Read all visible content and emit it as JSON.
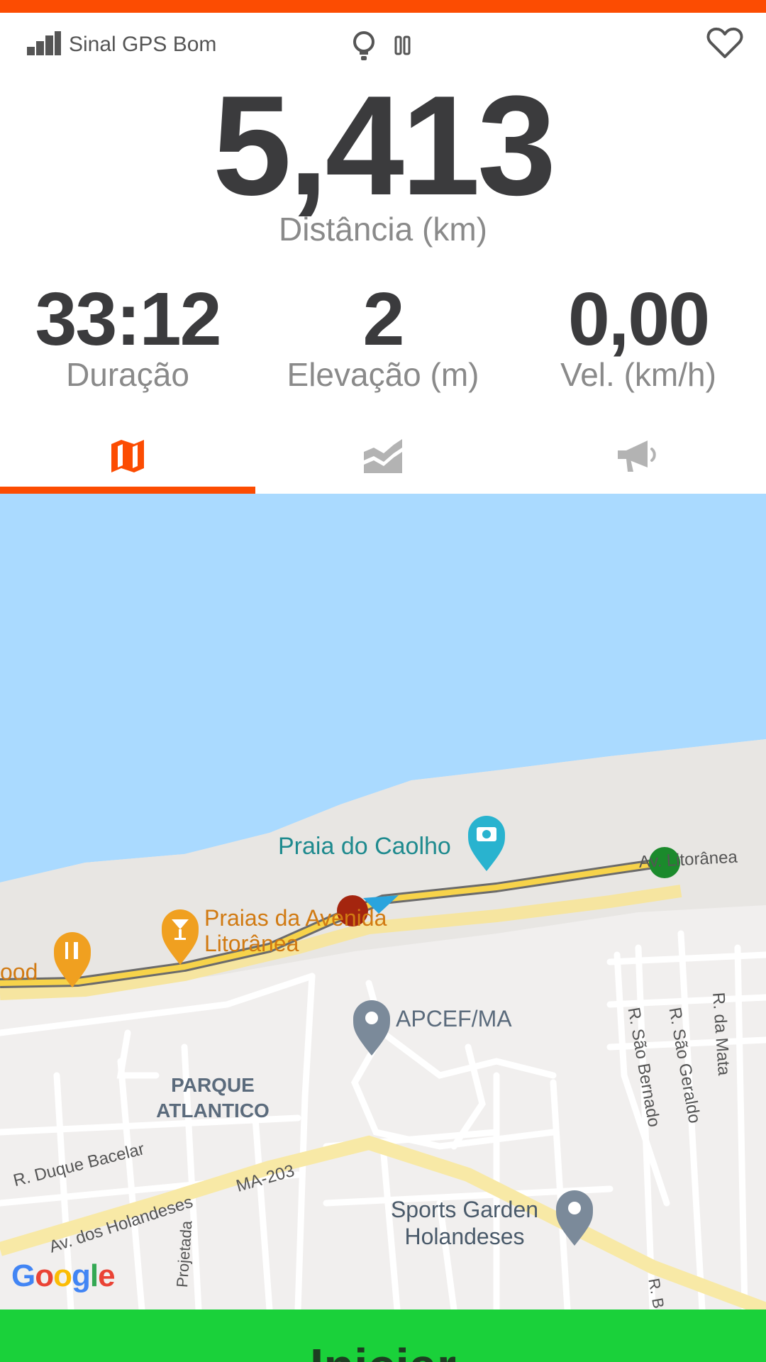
{
  "colors": {
    "accent": "#fc4c02",
    "text_dark": "#3b3b3d",
    "text_label": "#8a8a8a",
    "tab_inactive": "#b3b3b3",
    "water": "#aadaff",
    "route": "#f7d34a",
    "start_marker": "#1b8a2c",
    "current_marker": "#a4250f",
    "start_button": "#1ad13a"
  },
  "status": {
    "gps_text": "Sinal GPS Bom",
    "icons": [
      "signal-bars-icon",
      "lightbulb-icon",
      "pause-icon",
      "heart-icon"
    ]
  },
  "distance": {
    "value": "5,413",
    "label": "Distância (km)"
  },
  "stats": [
    {
      "value": "33:12",
      "label": "Duração"
    },
    {
      "value": "2",
      "label": "Elevação (m)"
    },
    {
      "value": "0,00",
      "label": "Vel. (km/h)"
    }
  ],
  "tabs": [
    {
      "icon": "map-icon",
      "active": true
    },
    {
      "icon": "area-chart-icon",
      "active": false
    },
    {
      "icon": "megaphone-icon",
      "active": false
    }
  ],
  "map": {
    "labels": {
      "praia_caolho": "Praia do Caolho",
      "praias_avenida": "Praias da Avenida\nLitorânea",
      "ood": "ood",
      "apcef": "APCEF/MA",
      "parque": "PARQUE\nATLANTICO",
      "sports_garden": "Sports Garden\nHolandeses",
      "duque_bacelar": "R. Duque Bacelar",
      "av_holandeses": "Av. dos Holandeses",
      "ma203": "MA-203",
      "projetada": "Projetada",
      "sao_bernardo": "R. São Bernado",
      "sao_geraldo": "R. São Geraldo",
      "da_mata": "R. da Mata",
      "litoranea": "Av. Litorânea",
      "r_b": "R. B"
    },
    "logo": "Google"
  },
  "start_button": "Iniciar"
}
